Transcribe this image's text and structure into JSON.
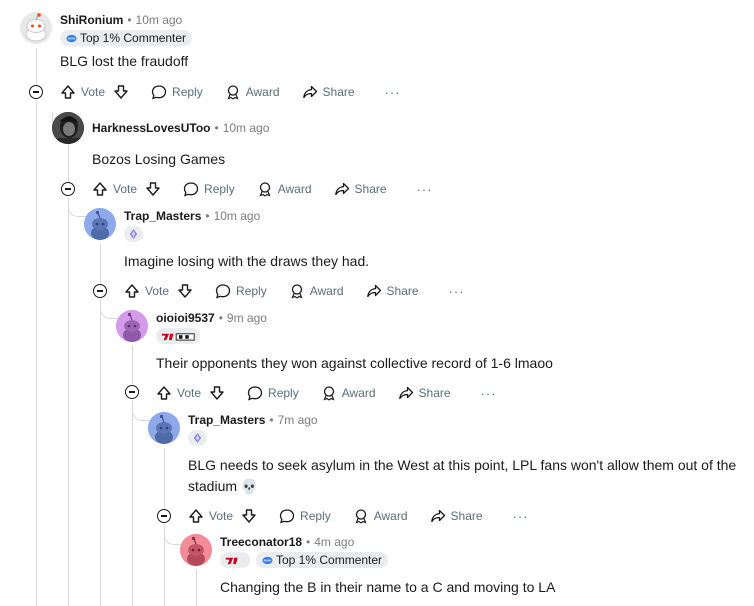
{
  "actions": {
    "vote": "Vote",
    "reply": "Reply",
    "award": "Award",
    "share": "Share",
    "more": "···"
  },
  "comments": [
    {
      "username": "ShiRonium",
      "time": "10m ago",
      "flair": "Top 1% Commenter",
      "text": "BLG lost the fraudoff",
      "avatar_color": "#e8e8e8"
    },
    {
      "username": "HarknessLovesUToo",
      "time": "10m ago",
      "text": "Bozos Losing Games",
      "avatar_color": "#3a3a3a"
    },
    {
      "username": "Trap_Masters",
      "time": "10m ago",
      "flair_icon": "diamond-icon",
      "text": "Imagine losing with the draws they had.",
      "avatar_color": "#8ea9ea"
    },
    {
      "username": "oioioi9537",
      "time": "9m ago",
      "flair_icon": "team-logo-icon",
      "text": "Their opponents they won against collective record of 1-6 lmaoo",
      "avatar_color": "#d59bea"
    },
    {
      "username": "Trap_Masters",
      "time": "7m ago",
      "flair_icon": "diamond-icon",
      "text_line1": "BLG needs to seek asylum in the West at this point, LPL fans won't allow them out of the",
      "text_line2": "stadium 💀",
      "avatar_color": "#8ea9ea"
    },
    {
      "username": "Treeconator18",
      "time": "4m ago",
      "flair": "Top 1% Commenter",
      "flair_icon": "team-logo-icon",
      "text": "Changing the B in their name to a C and moving to LA",
      "avatar_color": "#f28c99"
    }
  ]
}
